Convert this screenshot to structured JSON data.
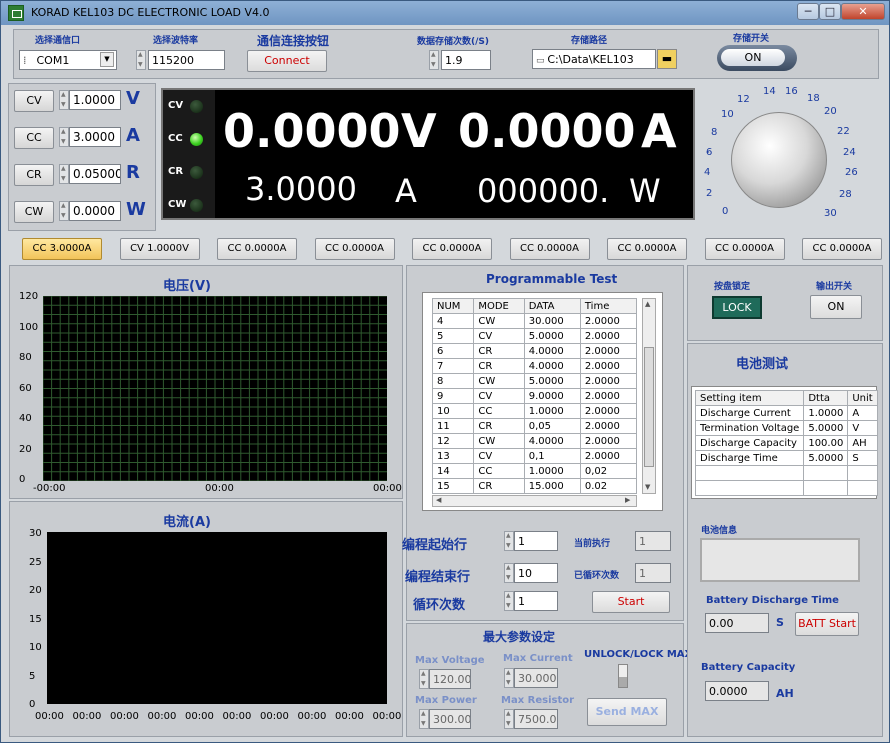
{
  "window": {
    "title": "KORAD KEL103 DC ELECTRONIC LOAD V4.0",
    "min": "─",
    "max": "□",
    "close": "✕"
  },
  "comm": {
    "port_label": "选择通信口",
    "port_value": "COM1",
    "baud_label": "选择波特率",
    "baud_value": "115200",
    "connect_label": "通信连接按钮",
    "connect_button": "Connect"
  },
  "storage": {
    "rate_label": "数据存储次数(/S)",
    "rate_value": "1.9",
    "path_label": "存储路径",
    "path_value": "C:\\Data\\KEL103",
    "switch_label": "存储开关",
    "switch_value": "ON"
  },
  "modes": [
    {
      "button": "CV",
      "value": "1.0000",
      "unit": "V"
    },
    {
      "button": "CC",
      "value": "3.0000",
      "unit": "A"
    },
    {
      "button": "CR",
      "value": "0.05000",
      "unit": "R"
    },
    {
      "button": "CW",
      "value": "0.0000",
      "unit": "W"
    }
  ],
  "display": {
    "leds": [
      {
        "label": "CV",
        "on": false
      },
      {
        "label": "CC",
        "on": true
      },
      {
        "label": "CR",
        "on": false
      },
      {
        "label": "CW",
        "on": false
      }
    ],
    "voltage": "0.0000",
    "voltage_unit": "V",
    "current": "0.0000",
    "current_unit": "A",
    "set_value": "3.0000",
    "set_unit": "A",
    "power": "000000.",
    "power_unit": "W"
  },
  "knob": {
    "scale": [
      "0",
      "2",
      "4",
      "6",
      "8",
      "10",
      "12",
      "14",
      "16",
      "18",
      "20",
      "22",
      "24",
      "26",
      "28",
      "30"
    ],
    "marker": "-"
  },
  "presets": [
    "CC 3.0000A",
    "CV 1.0000V",
    "CC 0.0000A",
    "CC 0.0000A",
    "CC 0.0000A",
    "CC 0.0000A",
    "CC 0.0000A",
    "CC 0.0000A",
    "CC 0.0000A"
  ],
  "voltage_chart": {
    "title": "电压(V)",
    "y_ticks": [
      "120",
      "100",
      "80",
      "60",
      "40",
      "20",
      "0"
    ],
    "x_ticks": [
      "-00:00",
      "00:00",
      "00:00"
    ]
  },
  "current_chart": {
    "title": "电流(A)",
    "y_ticks": [
      "30",
      "25",
      "20",
      "15",
      "10",
      "5",
      "0"
    ],
    "x_ticks": [
      "00:00",
      "00:00",
      "00:00",
      "00:00",
      "00:00",
      "00:00",
      "00:00",
      "00:00",
      "00:00",
      "00:00"
    ]
  },
  "program": {
    "title": "Programmable Test",
    "columns": [
      "NUM",
      "MODE",
      "DATA",
      "Time"
    ],
    "rows": [
      [
        "4",
        "CW",
        "30.000",
        "2.0000"
      ],
      [
        "5",
        "CV",
        "5.0000",
        "2.0000"
      ],
      [
        "6",
        "CR",
        "4.0000",
        "2.0000"
      ],
      [
        "7",
        "CR",
        "4.0000",
        "2.0000"
      ],
      [
        "8",
        "CW",
        "5.0000",
        "2.0000"
      ],
      [
        "9",
        "CV",
        "9.0000",
        "2.0000"
      ],
      [
        "10",
        "CC",
        "1.0000",
        "2.0000"
      ],
      [
        "11",
        "CR",
        "0,05",
        "2.0000"
      ],
      [
        "12",
        "CW",
        "4.0000",
        "2.0000"
      ],
      [
        "13",
        "CV",
        "0,1",
        "2.0000"
      ],
      [
        "14",
        "CC",
        "1.0000",
        "0,02"
      ],
      [
        "15",
        "CR",
        "15.000",
        "0.02"
      ]
    ],
    "start_row_label": "编程起始行",
    "start_row": "1",
    "end_row_label": "编程结束行",
    "end_row": "10",
    "loop_label": "循环次数",
    "loop": "1",
    "current_exec_label": "当前执行",
    "current_exec": "1",
    "loop_count_label": "已循环次数",
    "loop_count": "1",
    "start_button": "Start"
  },
  "max_params": {
    "title": "最大参数设定",
    "max_voltage_label": "Max Voltage",
    "max_voltage": "120.00",
    "max_current_label": "Max Current",
    "max_current": "30.000",
    "max_power_label": "Max Power",
    "max_power": "300.00",
    "max_resistor_label": "Max  Resistor",
    "max_resistor": "7500.0",
    "lock_label": "UNLOCK/LOCK MAX",
    "send_button": "Send MAX"
  },
  "lock": {
    "panel_lock_label": "按盘锁定",
    "lock_button": "LOCK",
    "output_label": "输出开关",
    "output_button": "ON"
  },
  "battery": {
    "title": "电池测试",
    "columns": [
      "Setting item",
      "Dtta",
      "Unit"
    ],
    "rows": [
      [
        "Discharge Current",
        "1.0000",
        "A"
      ],
      [
        "Termination Voltage",
        "5.0000",
        "V"
      ],
      [
        "Discharge Capacity",
        "100.00",
        "AH"
      ],
      [
        "Discharge Time",
        "5.0000",
        "S"
      ]
    ],
    "info_label": "电池信息",
    "discharge_time_label": "Battery Discharge Time",
    "discharge_time": "0.00",
    "discharge_time_unit": "S",
    "start_button": "BATT Start",
    "capacity_label": "Battery Capacity",
    "capacity": "0.0000",
    "capacity_unit": "AH"
  }
}
